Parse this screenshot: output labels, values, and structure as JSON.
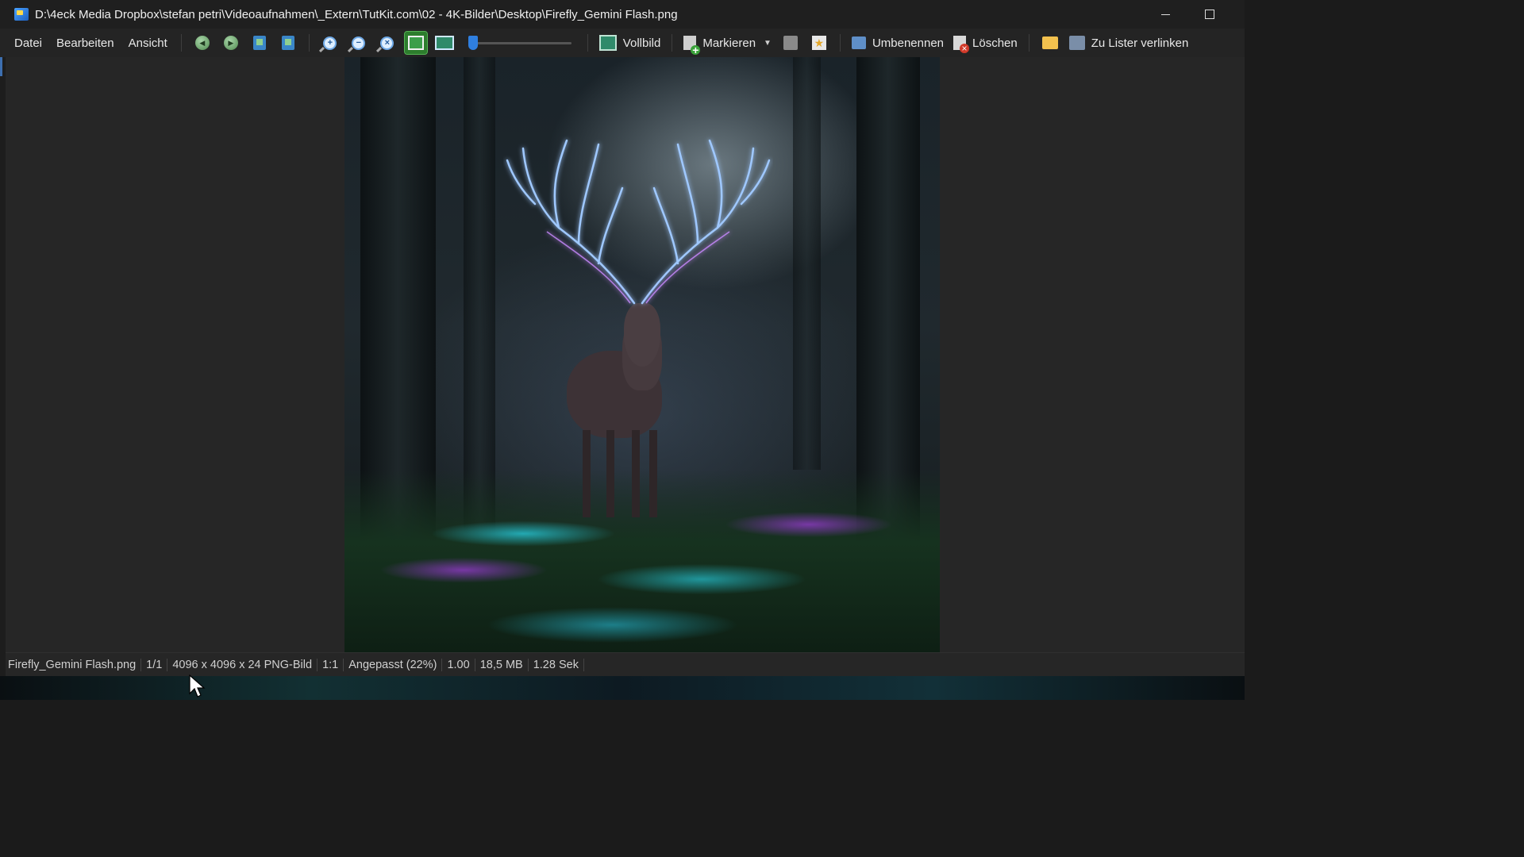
{
  "window": {
    "title": "D:\\4eck Media Dropbox\\stefan petri\\Videoaufnahmen\\_Extern\\TutKit.com\\02 - 4K-Bilder\\Desktop\\Firefly_Gemini Flash.png"
  },
  "menu": {
    "items": [
      "Datei",
      "Bearbeiten",
      "Ansicht"
    ]
  },
  "toolbar": {
    "fullscreen_label": "Vollbild",
    "mark_label": "Markieren",
    "rename_label": "Umbenennen",
    "delete_label": "Löschen",
    "link_label": "Zu Lister verlinken",
    "zoom_slider_level": 0.0,
    "icons": [
      "prev-icon",
      "next-icon",
      "copy-icon",
      "move-icon",
      "zoom-in-icon",
      "zoom-out-icon",
      "zoom-reset-icon",
      "fit-window-icon",
      "fit-width-icon"
    ]
  },
  "status": {
    "filename": "Firefly_Gemini Flash.png",
    "index": "1/1",
    "dimensions": "4096 x 4096 x 24 PNG-Bild",
    "ratio": "1:1",
    "zoom": "Angepasst (22%)",
    "gamma": "1.00",
    "size": "18,5 MB",
    "load_time": "1.28 Sek"
  },
  "colors": {
    "accent": "#2f7fe0",
    "active_button": "#2d7d2d"
  }
}
